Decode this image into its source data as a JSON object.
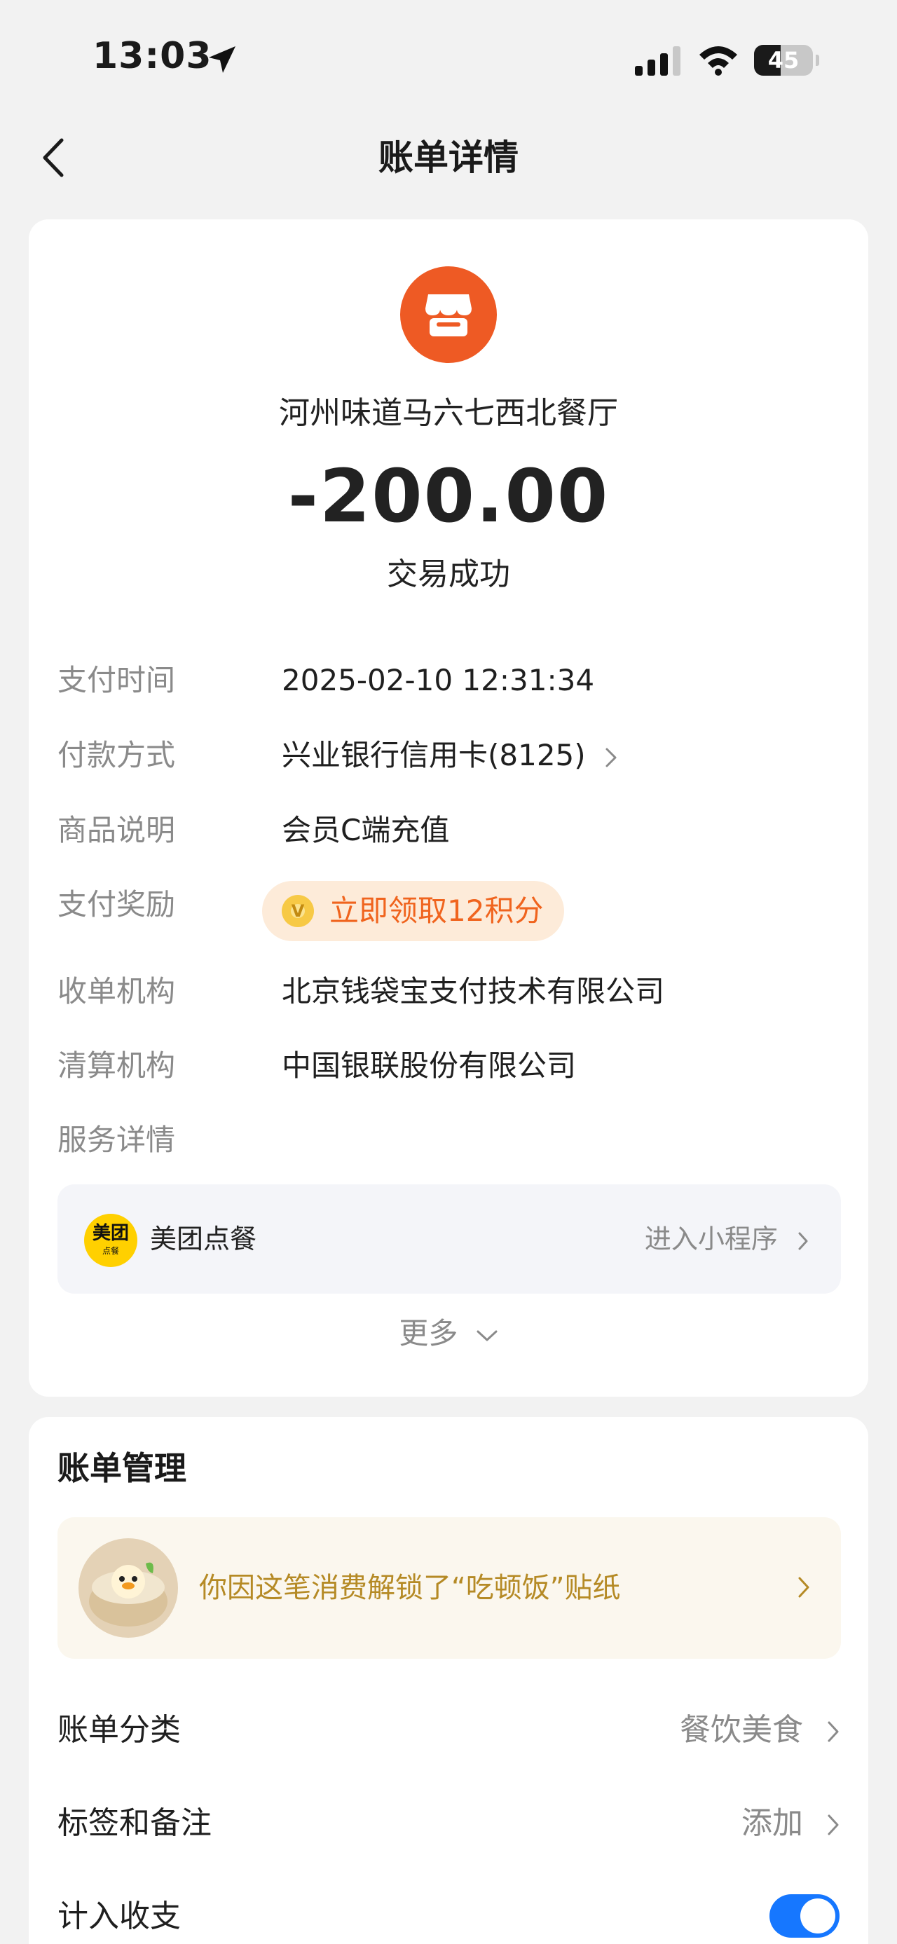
{
  "status_bar": {
    "time": "13:03",
    "battery": "45",
    "battery_level": 0.45,
    "icons": [
      "location-arrow-icon",
      "signal-icon",
      "wifi-icon",
      "battery-icon"
    ]
  },
  "nav": {
    "title": "账单详情",
    "back_icon": "chevron-left-icon"
  },
  "bill": {
    "merchant_icon": "store-icon",
    "merchant_name": "河州味道马六七西北餐厅",
    "amount": "-200.00",
    "status": "交易成功",
    "rows": {
      "pay_time": {
        "label": "支付时间",
        "value": "2025-02-10 12:31:34"
      },
      "pay_method": {
        "label": "付款方式",
        "value": "兴业银行信用卡(8125)"
      },
      "item_desc": {
        "label": "商品说明",
        "value": "会员C端充值"
      },
      "reward": {
        "label": "支付奖励",
        "value": "立即领取12积分",
        "icon_text": "V"
      },
      "acquirer": {
        "label": "收单机构",
        "value": "北京钱袋宝支付技术有限公司"
      },
      "clearing": {
        "label": "清算机构",
        "value": "中国银联股份有限公司"
      },
      "service": {
        "label": "服务详情"
      }
    },
    "service": {
      "logo_main": "美团",
      "logo_sub": "点餐",
      "name": "美团点餐",
      "link": "进入小程序"
    },
    "more": "更多"
  },
  "manage": {
    "title": "账单管理",
    "sticker_text": "你因这笔消费解锁了“吃顿饭”贴纸",
    "category": {
      "label": "账单分类",
      "value": "餐饮美食"
    },
    "tags": {
      "label": "标签和备注",
      "value": "添加"
    },
    "count": {
      "label": "计入收支",
      "enabled": true
    }
  },
  "colors": {
    "accent_orange": "#ee5a24",
    "reward_text": "#f0641e",
    "toggle_blue": "#1677ff",
    "sticker_text": "#b58a25"
  }
}
